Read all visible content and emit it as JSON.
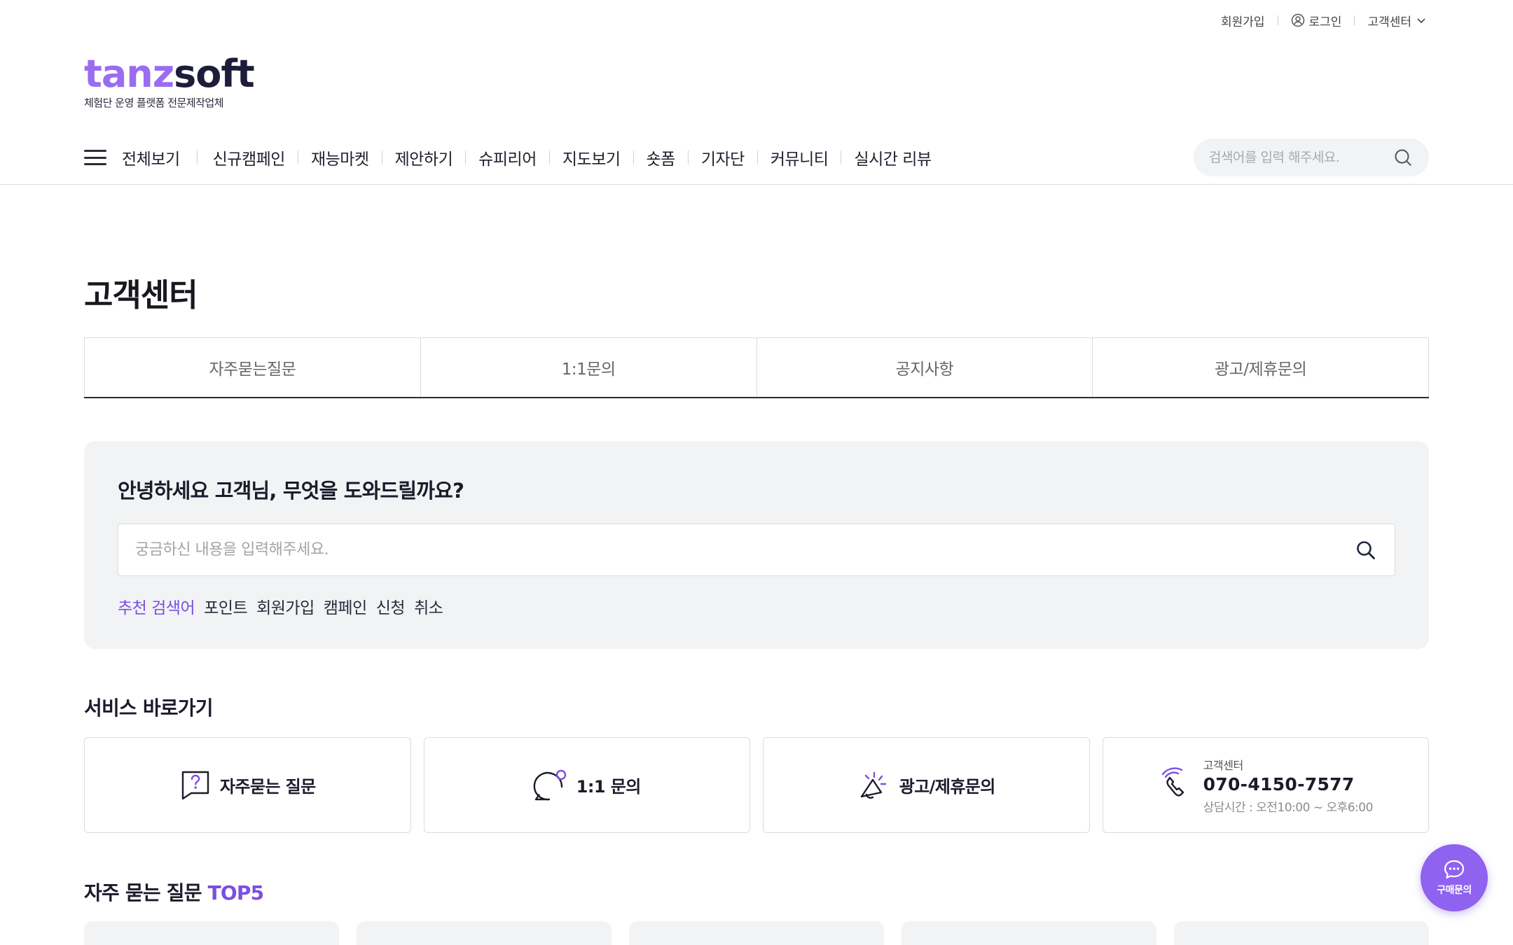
{
  "util": {
    "signup": "회원가입",
    "login": "로그인",
    "customer_center": "고객센터"
  },
  "logo": {
    "part1": "tanz",
    "part2": "soft",
    "subtitle": "체험단 운영 플랫폼 전문제작업체"
  },
  "nav": {
    "all": "전체보기",
    "items": [
      "신규캠페인",
      "재능마켓",
      "제안하기",
      "슈피리어",
      "지도보기",
      "숏폼",
      "기자단",
      "커뮤니티",
      "실시간 리뷰"
    ]
  },
  "top_search": {
    "placeholder": "검색어를 입력 해주세요."
  },
  "page": {
    "title": "고객센터"
  },
  "tabs": [
    "자주묻는질문",
    "1:1문의",
    "공지사항",
    "광고/제휴문의"
  ],
  "help": {
    "title": "안녕하세요 고객님, 무엇을 도와드릴까요?",
    "placeholder": "궁금하신 내용을 입력해주세요.",
    "recommend_label": "추천 검색어",
    "keywords": [
      "포인트",
      "회원가입",
      "캠페인",
      "신청",
      "취소"
    ]
  },
  "services": {
    "title": "서비스 바로가기",
    "faq": "자주묻는 질문",
    "inquiry": "1:1 문의",
    "ad": "광고/제휴문의",
    "cc_label": "고객센터",
    "cc_phone": "070-4150-7577",
    "cc_hours": "상담시간 : 오전10:00 ~ 오후6:00"
  },
  "faq_top": {
    "title": "자주 묻는 질문",
    "accent": "TOP5"
  },
  "fab": {
    "label": "구매문의"
  },
  "colors": {
    "accent": "#7b4fe0",
    "fab": "#8f62ef",
    "panel_bg": "#f2f3f5"
  }
}
